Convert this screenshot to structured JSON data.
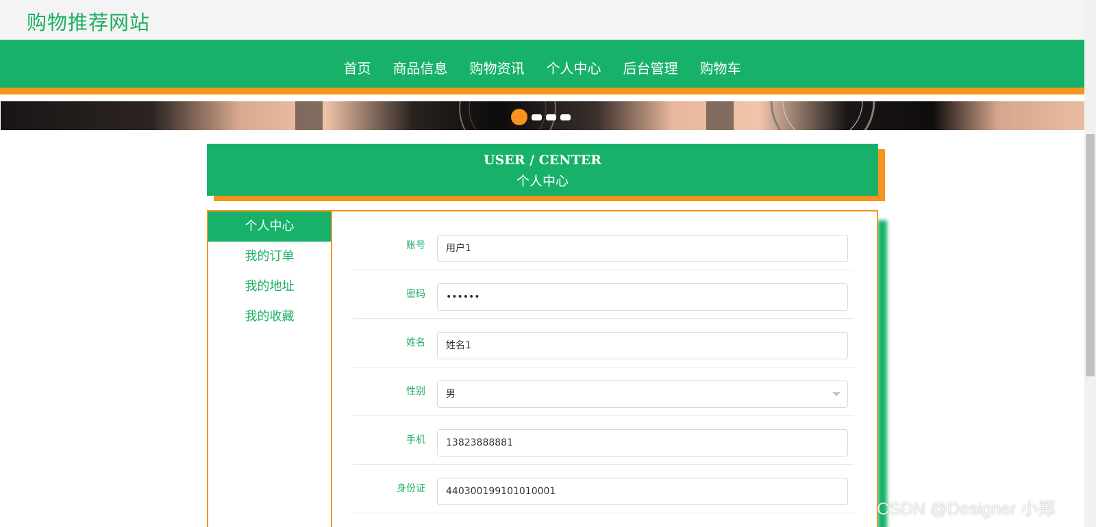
{
  "site": {
    "title": "购物推荐网站"
  },
  "nav": {
    "items": [
      "首页",
      "商品信息",
      "购物资讯",
      "个人中心",
      "后台管理",
      "购物车"
    ]
  },
  "banner": {
    "slide_count": 4,
    "active_slide": 1
  },
  "section": {
    "title_en": "USER / CENTER",
    "title_cn": "个人中心"
  },
  "sidebar": {
    "items": [
      {
        "label": "个人中心",
        "active": true
      },
      {
        "label": "我的订单",
        "active": false
      },
      {
        "label": "我的地址",
        "active": false
      },
      {
        "label": "我的收藏",
        "active": false
      }
    ]
  },
  "form": {
    "account": {
      "label": "账号",
      "value": "用户1"
    },
    "password": {
      "label": "密码",
      "value": "••••••"
    },
    "name": {
      "label": "姓名",
      "value": "姓名1"
    },
    "gender": {
      "label": "性别",
      "value": "男"
    },
    "phone": {
      "label": "手机",
      "value": "13823888881"
    },
    "id_card": {
      "label": "身份证",
      "value": "440300199101010001"
    }
  },
  "watermark": "CSDN @Designer 小郑",
  "colors": {
    "primary": "#17b16a",
    "accent": "#f7941d",
    "title_green": "#1cae63"
  }
}
